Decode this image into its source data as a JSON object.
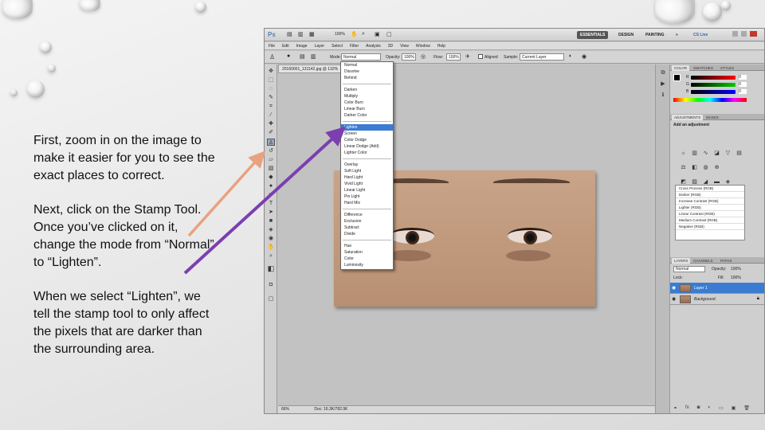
{
  "instructions": {
    "paragraph1": "First, zoom in on the image to make it easier for you to see the exact places to correct.",
    "paragraph2": "Next, click on the Stamp Tool.  Once you’ve clicked on it, change the mode from “Normal” to “Lighten”.",
    "paragraph3": "When we select “Lighten”, we tell the stamp tool to only affect the pixels that are darker than the surrounding area."
  },
  "arrows": [
    {
      "name": "peach-arrow",
      "color": "#e8a27f"
    },
    {
      "name": "purple-arrow",
      "color": "#7b3fb0"
    }
  ],
  "photoshop": {
    "logo": "Ps",
    "zoom": "100%",
    "workspaces": [
      "ESSENTIALS",
      "DESIGN",
      "PAINTING",
      "»",
      "CS Live"
    ],
    "menu": [
      "File",
      "Edit",
      "Image",
      "Layer",
      "Select",
      "Filter",
      "Analysis",
      "3D",
      "View",
      "Window",
      "Help"
    ],
    "options": {
      "mode_label": "Mode:",
      "mode_value": "Normal",
      "opacity_label": "Opacity:",
      "opacity_value": "100%",
      "flow_label": "Flow:",
      "flow_value": "100%",
      "aligned": "Aligned",
      "sample_label": "Sample:",
      "sample_value": "Current Layer"
    },
    "document_tab": "20160001_131142.jpg @ 132%",
    "status": {
      "zoom": "66%",
      "doc": "Doc: 16.3K/782.9K"
    },
    "blend_modes": [
      [
        "Normal",
        "Dissolve",
        "Behind"
      ],
      [
        "Darken",
        "Multiply",
        "Color Burn",
        "Linear Burn",
        "Darker Color"
      ],
      [
        "Lighten",
        "Screen",
        "Color Dodge",
        "Linear Dodge (Add)",
        "Lighter Color"
      ],
      [
        "Overlay",
        "Soft Light",
        "Hard Light",
        "Vivid Light",
        "Linear Light",
        "Pin Light",
        "Hard Mix"
      ],
      [
        "Difference",
        "Exclusion",
        "Subtract",
        "Divide"
      ],
      [
        "Hue",
        "Saturation",
        "Color",
        "Luminosity"
      ]
    ],
    "highlighted_mode": "Lighten",
    "color_panel": {
      "tabs": [
        "COLOR",
        "SWATCHES",
        "STYLES"
      ],
      "channels": [
        "R",
        "G",
        "B"
      ],
      "values": [
        "0",
        "0",
        "0"
      ]
    },
    "adjustments_panel": {
      "tabs": [
        "ADJUSTMENTS",
        "MASKS"
      ],
      "title": "Add an adjustment",
      "presets": [
        "Cross Process (RGB)",
        "Darker (RGB)",
        "Increase Contrast (RGB)",
        "Lighter (RGB)",
        "Linear Contrast (RGB)",
        "Medium Contrast (RGB)",
        "Negative (RGB)"
      ]
    },
    "layers_panel": {
      "tabs": [
        "LAYERS",
        "CHANNELS",
        "PATHS"
      ],
      "blend": "Normal",
      "opacity_label": "Opacity:",
      "opacity_value": "100%",
      "lock_label": "Lock:",
      "fill_label": "Fill:",
      "fill_value": "100%",
      "layers": [
        "Layer 1",
        "Background"
      ]
    }
  }
}
